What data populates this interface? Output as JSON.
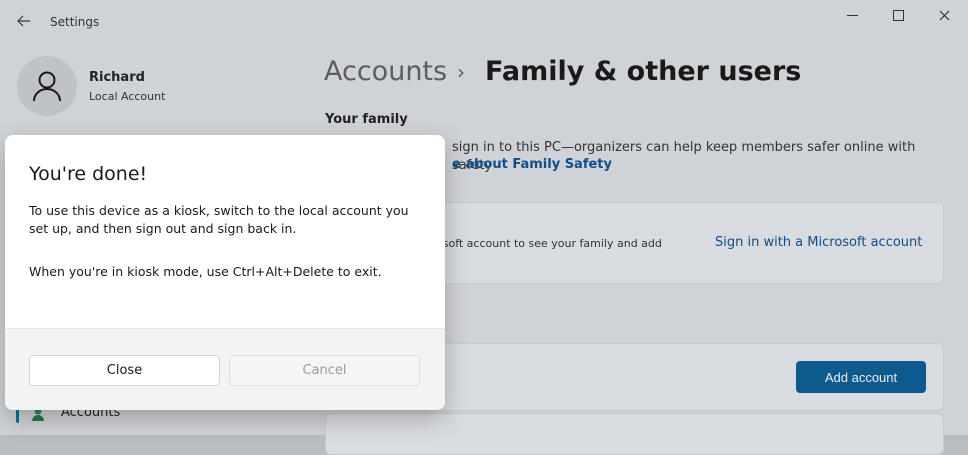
{
  "window": {
    "title": "Settings",
    "controls": [
      "minimize-icon",
      "maximize-icon",
      "close-icon"
    ]
  },
  "sidebar": {
    "user": {
      "name": "Richard",
      "account_type": "Local Account"
    },
    "nav": {
      "accounts_label": "Accounts"
    }
  },
  "main": {
    "breadcrumb": {
      "root": "Accounts",
      "separator": "›",
      "current": "Family & other users"
    },
    "your_family": {
      "title": "Your family",
      "description": "sign in to this PC—organizers can help keep members safer online with safety",
      "link": "e about Family Safety",
      "signin_card_text": "osoft account to see your family and add",
      "signin_link": "Sign in with a Microsoft account"
    },
    "other_users": {
      "add_button": "Add account"
    }
  },
  "dialog": {
    "title": "You're done!",
    "body1": "To use this device as a kiosk, switch to the local account you set up, and then sign out and sign back in.",
    "body2": "When you're in kiosk mode, use Ctrl+Alt+Delete to exit.",
    "buttons": {
      "close": "Close",
      "cancel": "Cancel"
    }
  },
  "colors": {
    "accent": "#0d5a8e",
    "link": "#0f4e8a",
    "overlay_bg": "#cfd2d6",
    "dialog_bg": "#ffffff"
  }
}
